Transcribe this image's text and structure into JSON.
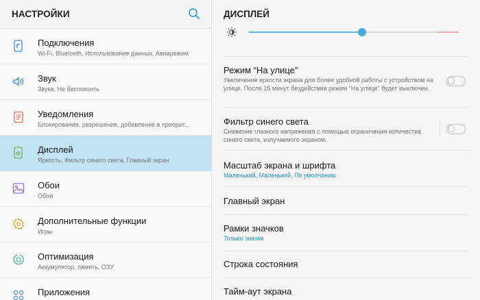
{
  "left": {
    "title": "НАСТРОЙКИ",
    "items": [
      {
        "title": "Подключения",
        "subtitle": "Wi-Fi, Bluetooth, Использование данных, Авиарежим",
        "icon": "connections-icon",
        "selected": false
      },
      {
        "title": "Звук",
        "subtitle": "Звуки, Не беспокоить",
        "icon": "sound-icon",
        "selected": false
      },
      {
        "title": "Уведомления",
        "subtitle": "Блокирование, разрешение, добавление в приорит...",
        "icon": "notifications-icon",
        "selected": false
      },
      {
        "title": "Дисплей",
        "subtitle": "Яркость, Фильтр синего света, Главный экран",
        "icon": "display-icon",
        "selected": true
      },
      {
        "title": "Обои",
        "subtitle": "Обои",
        "icon": "wallpaper-icon",
        "selected": false
      },
      {
        "title": "Дополнительные функции",
        "subtitle": "Игры",
        "icon": "advanced-features-icon",
        "selected": false
      },
      {
        "title": "Оптимизация",
        "subtitle": "Аккумулятор, память, ОЗУ",
        "icon": "optimization-icon",
        "selected": false
      },
      {
        "title": "Приложения",
        "subtitle": "",
        "icon": "apps-icon",
        "selected": false
      }
    ]
  },
  "right": {
    "title": "ДИСПЛЕЙ",
    "brightness": {
      "level": 0.54,
      "icon": "brightness-icon"
    },
    "outdoor_mode": {
      "title": "Режим “На улице”",
      "description": "Увеличение яркости экрана для более удобной работы с устройством на улице. После 15 минут бездействия режим \"На улице\" будет выключен.",
      "enabled": false
    },
    "blue_light_filter": {
      "title": "Фильтр синего света",
      "description": "Снижение глазного напряжения с помощью ограничения количества синего света, излучаемого экраном.",
      "enabled": false
    },
    "screen_zoom": {
      "title": "Масштаб экрана и шрифта",
      "value": "Маленький, Маленький, По умолчанию"
    },
    "home_screen": {
      "title": "Главный экран"
    },
    "icon_frames": {
      "title": "Рамки значков",
      "value": "Только значки"
    },
    "status_bar": {
      "title": "Строка состояния"
    },
    "screen_timeout": {
      "title": "Тайм-аут экрана"
    }
  },
  "colors": {
    "accent": "#4aa9db",
    "selected_bg": "#c2e3f2",
    "link": "#2a8fca"
  }
}
